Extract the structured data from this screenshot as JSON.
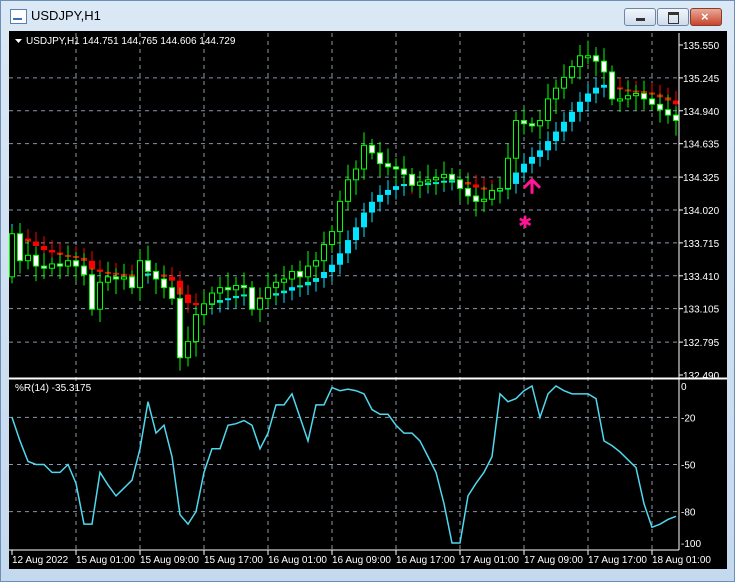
{
  "window": {
    "title": "USDJPY,H1",
    "minimize": "minimize",
    "maximize": "maximize",
    "close": "×"
  },
  "chart_header": "USDJPY,H1  144.751 144.765 144.606 144.729",
  "indicator_header": "%R(14) -35.3175",
  "colors": {
    "background": "#000000",
    "grid": "#8a97a8",
    "bull_candle": "#00ff00",
    "bear_candle_fill": "#ffffff",
    "overlay_up": "#00e5ff",
    "overlay_down": "#ff0000",
    "signal": "#ff1493",
    "wpr_line": "#4fd8ee"
  },
  "chart_data": [
    {
      "type": "candlestick",
      "symbol": "USDJPY",
      "timeframe": "H1",
      "price_ticks": [
        "135.550",
        "135.245",
        "134.940",
        "134.635",
        "134.325",
        "134.020",
        "133.715",
        "133.410",
        "133.105",
        "132.795",
        "132.490"
      ],
      "ylim": [
        132.49,
        135.55
      ],
      "time_ticks": [
        "12 Aug 2022",
        "15 Aug 01:00",
        "15 Aug 09:00",
        "15 Aug 17:00",
        "16 Aug 01:00",
        "16 Aug 09:00",
        "16 Aug 17:00",
        "17 Aug 01:00",
        "17 Aug 09:00",
        "17 Aug 17:00",
        "18 Aug 01:00"
      ],
      "grid": true,
      "first_open": 133.4,
      "close": [
        133.8,
        133.55,
        133.6,
        133.5,
        133.48,
        133.52,
        133.5,
        133.55,
        133.5,
        133.42,
        133.1,
        133.35,
        133.4,
        133.38,
        133.4,
        133.3,
        133.55,
        133.45,
        133.38,
        133.3,
        133.2,
        132.65,
        132.8,
        133.05,
        133.15,
        133.25,
        133.3,
        133.28,
        133.32,
        133.3,
        133.1,
        133.2,
        133.3,
        133.35,
        133.38,
        133.45,
        133.4,
        133.5,
        133.55,
        133.7,
        133.82,
        134.1,
        134.3,
        134.4,
        134.62,
        134.55,
        134.45,
        134.42,
        134.4,
        134.35,
        134.25,
        134.28,
        134.3,
        134.32,
        134.35,
        134.3,
        134.22,
        134.15,
        134.1,
        134.12,
        134.2,
        134.22,
        134.5,
        134.85,
        134.82,
        134.8,
        134.85,
        135.05,
        135.15,
        135.25,
        135.35,
        135.45,
        135.45,
        135.4,
        135.3,
        135.05,
        135.05,
        135.08,
        135.1,
        135.05,
        135.0,
        134.95,
        134.9,
        134.85
      ],
      "signals": [
        {
          "type": "arrow-up",
          "bar": 65,
          "price": 134.3
        },
        {
          "type": "star",
          "bar": 64,
          "price": 133.91
        }
      ]
    },
    {
      "type": "line",
      "name": "%R(14)",
      "ylim": [
        -100,
        0
      ],
      "y_ticks": [
        "0",
        "-20",
        "-50",
        "-80",
        "-100"
      ],
      "values": [
        -20,
        -35,
        -48,
        -50,
        -50,
        -55,
        -55,
        -50,
        -62,
        -88,
        -88,
        -55,
        -63,
        -70,
        -65,
        -60,
        -40,
        -10,
        -30,
        -25,
        -45,
        -82,
        -88,
        -80,
        -55,
        -40,
        -40,
        -25,
        -24,
        -22,
        -25,
        -40,
        -30,
        -12,
        -12,
        -5,
        -20,
        -35,
        -12,
        -12,
        -1,
        -3,
        -2,
        -3,
        -5,
        -15,
        -18,
        -18,
        -25,
        -30,
        -30,
        -35,
        -45,
        -55,
        -75,
        -100,
        -100,
        -70,
        -62,
        -55,
        -45,
        -5,
        -10,
        -8,
        -3,
        0,
        -20,
        -5,
        0,
        -3,
        -5,
        -5,
        -5,
        -8,
        -35,
        -38,
        -42,
        -47,
        -52,
        -75,
        -90,
        -88,
        -85,
        -83
      ]
    }
  ]
}
